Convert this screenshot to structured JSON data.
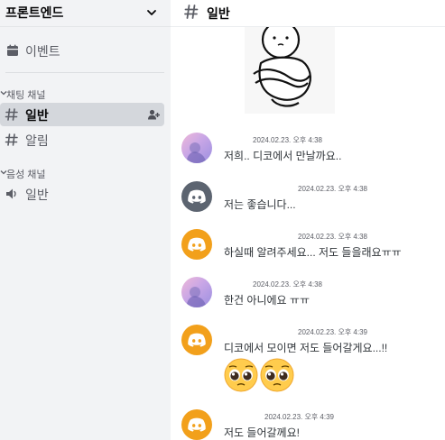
{
  "sidebar": {
    "server_name": "프론트엔드",
    "events_label": "이벤트",
    "categories": [
      {
        "label": "채팅 채널"
      },
      {
        "label": "음성 채널"
      }
    ],
    "text_channels": [
      {
        "label": "일반"
      },
      {
        "label": "알림"
      }
    ],
    "voice_channels": [
      {
        "label": "일반"
      }
    ]
  },
  "channel_header": {
    "title": "일반"
  },
  "messages": [
    {
      "timestamp": "2024.02.23. 오후 4:38",
      "text": "저희.. 디코에서 만날까요..",
      "avatar": "profile-photo"
    },
    {
      "timestamp": "2024.02.23. 오후 4:38",
      "text": "저는 좋습니다...",
      "avatar": "discord-gray"
    },
    {
      "timestamp": "2024.02.23. 오후 4:38",
      "text": "하실때 알려주세요... 저도 들을래요ㅠㅠ",
      "avatar": "discord-orange"
    },
    {
      "timestamp": "2024.02.23. 오후 4:38",
      "text": "한건 아니에요 ㅠㅠ",
      "avatar": "profile-photo"
    },
    {
      "timestamp": "2024.02.23. 오후 4:39",
      "text": "디코에서 모이면 저도 들어갈게요...!!",
      "avatar": "discord-orange",
      "emoji": [
        "pleading-face",
        "pleading-face"
      ]
    },
    {
      "timestamp": "2024.02.23. 오후 4:39",
      "text": "저도 들어갈께요!",
      "avatar": "discord-orange"
    }
  ],
  "colors": {
    "sidebar_bg": "#f2f3f5",
    "active_channel_bg": "#d4d7dc",
    "discord_gray": "#5c6470",
    "discord_orange": "#f2a01b"
  }
}
